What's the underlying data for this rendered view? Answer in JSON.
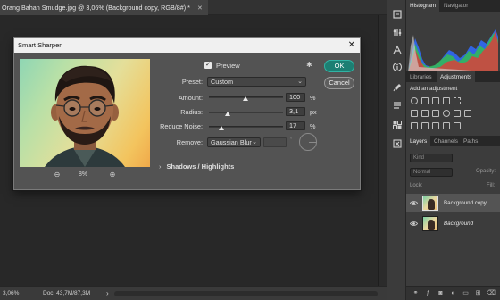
{
  "document": {
    "tab_title": "Orang Bahan Smudge.jpg @ 3,06% (Background copy, RGB/8#) *",
    "close_symbol": "✕"
  },
  "status_bar": {
    "zoom": "3,06%",
    "doc_info": "Doc: 43,7M/87,3M",
    "arrow": "›"
  },
  "toolstrip": {
    "icons": [
      "history-icon",
      "properties-icon",
      "character-icon",
      "paragraph-icon",
      "info-icon",
      "brush-settings-icon",
      "brushes-icon",
      "swatches-icon",
      "glyphs-icon"
    ]
  },
  "panels": {
    "top_tabs": [
      "Histogram",
      "Navigator"
    ],
    "mid_tabs": [
      "Libraries",
      "Adjustments"
    ],
    "adjustments_title": "Add an adjustment",
    "layer_tabs": [
      "Layers",
      "Channels",
      "Paths"
    ],
    "kind_placeholder": "Kind",
    "blend_mode": "Normal",
    "opacity_label": "Opacity:",
    "lock_label": "Lock:",
    "fill_label": "Fill:",
    "layers": [
      {
        "name": "Background copy",
        "selected": true,
        "italic": false
      },
      {
        "name": "Background",
        "selected": false,
        "italic": true
      }
    ]
  },
  "dialog": {
    "title": "Smart Sharpen",
    "close_symbol": "✕",
    "zoom_out_symbol": "⊖",
    "zoom_in_symbol": "⊕",
    "zoom_level": "8%",
    "preview_checked": true,
    "preview_check_mark": "✓",
    "preview_label": "Preview",
    "gear_symbol": "✱",
    "ok_label": "OK",
    "cancel_label": "Cancel",
    "preset": {
      "label": "Preset:",
      "value": "Custom"
    },
    "amount": {
      "label": "Amount:",
      "value": "100",
      "unit": "%",
      "level": 0.49
    },
    "radius": {
      "label": "Radius:",
      "value": "3,1",
      "unit": "px",
      "level": 0.25
    },
    "reduce_noise": {
      "label": "Reduce Noise:",
      "value": "17",
      "unit": "%",
      "level": 0.17
    },
    "remove": {
      "label": "Remove:",
      "value": "Gaussian Blur"
    },
    "degree_symbol": "°",
    "shadows_highlights": "Shadows / Highlights",
    "chevron_symbol": "›",
    "dropdown_symbol": "⌄"
  },
  "colors": {
    "ok_accent": "#1c7f73",
    "ok_border": "#31b3a4"
  }
}
